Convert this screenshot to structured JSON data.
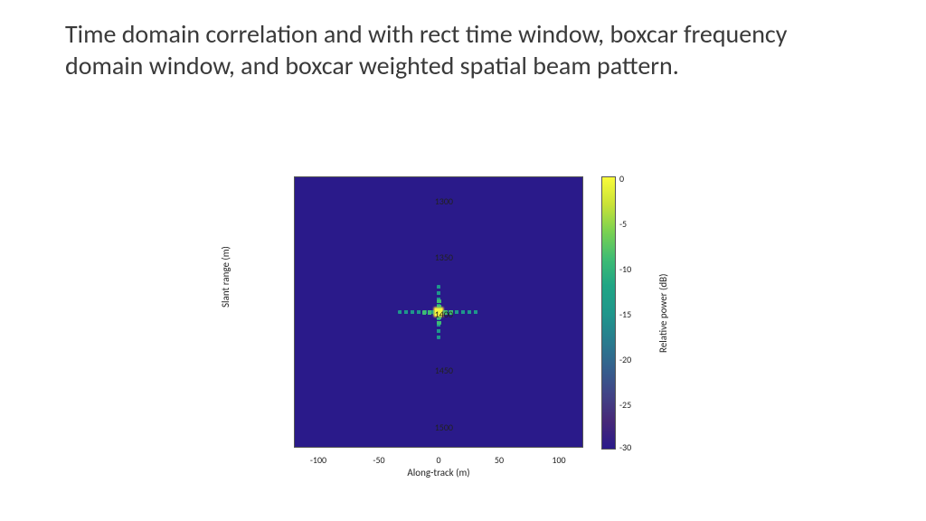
{
  "title_text": "Time domain correlation and with rect time window, boxcar frequency domain window, and boxcar weighted spatial beam pattern.",
  "chart_data": {
    "type": "heatmap",
    "title": "",
    "xlabel": "Along-track (m)",
    "ylabel": "Slant range (m)",
    "colorbar_label": "Relative power (dB)",
    "x_range": [
      -120,
      120
    ],
    "y_range": [
      1280,
      1520
    ],
    "x_ticks": [
      -100,
      -50,
      0,
      50,
      100
    ],
    "y_ticks": [
      1300,
      1350,
      1400,
      1450,
      1500
    ],
    "colorbar_range": [
      -30,
      0
    ],
    "colorbar_ticks": [
      0,
      -5,
      -10,
      -15,
      -20,
      -25,
      -30
    ],
    "colormap": "parula",
    "description": "Point spread function (sinc-like) centred near along-track 0 m, slant range ~1410 m. Background at -30 dB. Mainlobe peak 0 dB, sidelobes along both axes decaying to roughly -25 dB within ±40 m along-track and ±25 m slant-range of the peak.",
    "peak": {
      "x": 0,
      "y": 1410,
      "value_db": 0
    },
    "sidelobe_extent": {
      "along_track_m": 40,
      "slant_range_m": 25
    },
    "background_db": -30
  }
}
